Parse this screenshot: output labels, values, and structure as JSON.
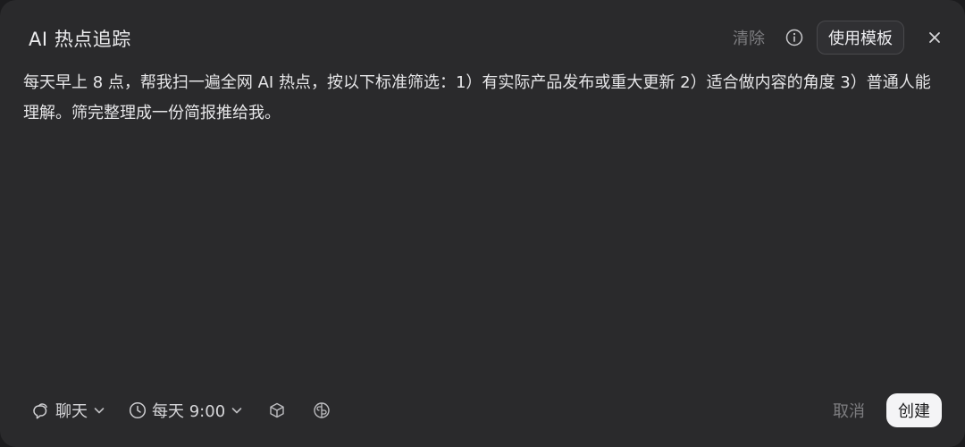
{
  "dialog": {
    "title": "AI 热点追踪",
    "actions": {
      "clear_label": "清除",
      "info_icon": "info-icon",
      "template_label": "使用模板",
      "close_icon": "close-icon"
    }
  },
  "prompt": {
    "text": "每天早上 8 点，帮我扫一遍全网 AI 热点，按以下标准筛选：1）有实际产品发布或重大更新 2）适合做内容的角度 3）普通人能理解。筛完整理成一份简报推给我。"
  },
  "footer": {
    "mode": {
      "icon": "chat-bubble-icon",
      "label": "聊天",
      "chevron": "chevron-down-icon"
    },
    "schedule": {
      "icon": "clock-icon",
      "label": "每天 9:00",
      "chevron": "chevron-down-icon"
    },
    "tools": [
      {
        "icon": "cube-icon"
      },
      {
        "icon": "brain-icon"
      }
    ],
    "cancel_label": "取消",
    "create_label": "创建"
  },
  "colors": {
    "background": "#2a2a2c",
    "text": "#e6e6e8",
    "muted": "#7d7d80",
    "primary_button": "#f4f4f6"
  }
}
